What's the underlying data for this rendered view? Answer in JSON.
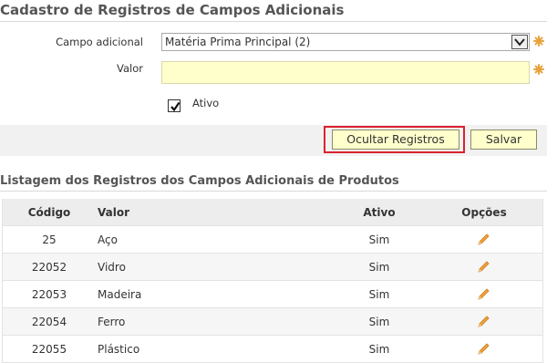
{
  "page": {
    "title": "Cadastro de Registros de Campos Adicionais"
  },
  "form": {
    "campo_label": "Campo adicional",
    "campo_value": "Matéria Prima Principal (2)",
    "valor_label": "Valor",
    "valor_value": "",
    "ativo_label": "Ativo",
    "ativo_checked": true,
    "required_color": "#e8a33c"
  },
  "actions": {
    "ocultar_label": "Ocultar Registros",
    "salvar_label": "Salvar",
    "highlight_color": "#d9232e"
  },
  "list": {
    "title": "Listagem dos Registros dos Campos Adicionais de Produtos",
    "headers": {
      "codigo": "Código",
      "valor": "Valor",
      "ativo": "Ativo",
      "opcoes": "Opções"
    },
    "rows": [
      {
        "codigo": "25",
        "valor": "Aço",
        "ativo": "Sim",
        "icon": "pencil-edit-icon"
      },
      {
        "codigo": "22052",
        "valor": "Vidro",
        "ativo": "Sim",
        "icon": "pencil-edit-icon"
      },
      {
        "codigo": "22053",
        "valor": "Madeira",
        "ativo": "Sim",
        "icon": "pencil-edit-icon"
      },
      {
        "codigo": "22054",
        "valor": "Ferro",
        "ativo": "Sim",
        "icon": "pencil-edit-icon"
      },
      {
        "codigo": "22055",
        "valor": "Plástico",
        "ativo": "Sim",
        "icon": "pencil-edit-icon"
      }
    ]
  }
}
